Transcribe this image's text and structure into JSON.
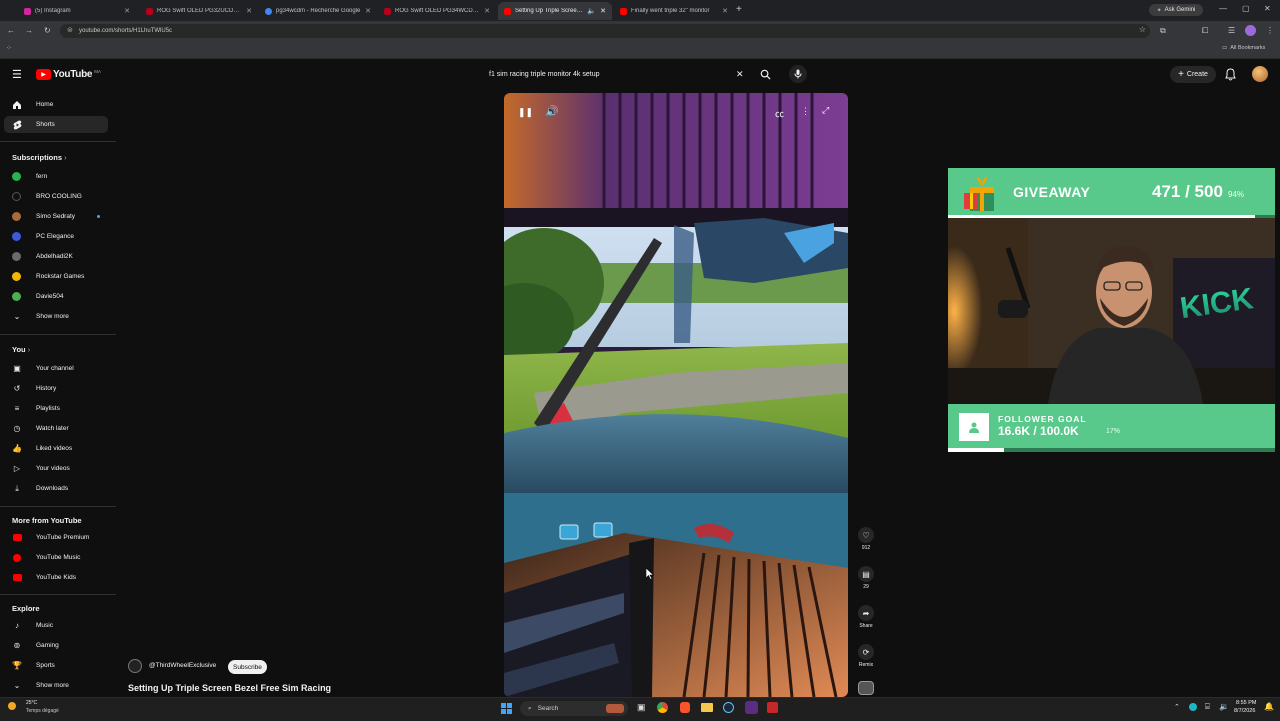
{
  "browser": {
    "tabs": [
      {
        "label": "(5) Instagram",
        "color": "#d6249f"
      },
      {
        "label": "ROG Swift OLED PG32UCDM3 |",
        "color": "#b3001b"
      },
      {
        "label": "pg34wcdm - Recherche Google",
        "color": "#4285f4"
      },
      {
        "label": "ROG Swift OLED PG34WCDM |",
        "color": "#b3001b"
      },
      {
        "label": "Setting Up Triple Screen Be",
        "color": "#ff0000"
      },
      {
        "label": "Finally went triple 32\" monitor",
        "color": "#ff0000"
      }
    ],
    "gemini": "Ask Gemini",
    "url": "youtube.com/shorts/H1LhuTWlU5c",
    "all_bookmarks": "All Bookmarks"
  },
  "youtube": {
    "logo": "YouTube",
    "region": "MA",
    "search_query": "f1 sim racing triple monitor 4k setup",
    "create": "Create"
  },
  "sidebar": {
    "main": [
      {
        "label": "Home",
        "icon": "home-icon"
      },
      {
        "label": "Shorts",
        "icon": "shorts-icon"
      }
    ],
    "subscriptions_title": "Subscriptions",
    "subscriptions": [
      {
        "label": "fern",
        "color": "#2bb24c"
      },
      {
        "label": "BRO COOLING",
        "color": "#111111"
      },
      {
        "label": "Simo Sedraty",
        "color": "#a86b3c"
      },
      {
        "label": "PC Elegance",
        "color": "#3b5bdb"
      },
      {
        "label": "Abdelhadi2K",
        "color": "#6b6b6b"
      },
      {
        "label": "Rockstar Games",
        "color": "#f2b705"
      },
      {
        "label": "Davie504",
        "color": "#4caf50"
      }
    ],
    "show_more": "Show more",
    "you_title": "You",
    "you": [
      {
        "label": "Your channel",
        "icon": "channel-icon"
      },
      {
        "label": "History",
        "icon": "history-icon"
      },
      {
        "label": "Playlists",
        "icon": "playlist-icon"
      },
      {
        "label": "Watch later",
        "icon": "clock-icon"
      },
      {
        "label": "Liked videos",
        "icon": "like-icon"
      },
      {
        "label": "Your videos",
        "icon": "video-icon"
      },
      {
        "label": "Downloads",
        "icon": "download-icon"
      }
    ],
    "more_title": "More from YouTube",
    "more": [
      {
        "label": "YouTube Premium"
      },
      {
        "label": "YouTube Music"
      },
      {
        "label": "YouTube Kids"
      }
    ],
    "explore_title": "Explore",
    "explore": [
      {
        "label": "Music",
        "icon": "music-icon"
      },
      {
        "label": "Gaming",
        "icon": "gaming-icon"
      },
      {
        "label": "Sports",
        "icon": "trophy-icon"
      }
    ],
    "explore_more": "Show more"
  },
  "short": {
    "channel": "@ThirdWheelExclusive",
    "subscribe": "Subscribe",
    "title": "Setting Up Triple Screen Bezel Free Sim Racing",
    "likes": "912",
    "comments": "29",
    "share": "Share",
    "remix": "Remix"
  },
  "overlay": {
    "giveaway": "GIVEAWAY",
    "giveaway_count": "471 / 500",
    "giveaway_pct": "94%",
    "giveaway_progress": 0.94,
    "follower_label": "FOLLOWER GOAL",
    "follower_count": "16.6K / 100.0K",
    "follower_pct": "17%",
    "follower_progress": 0.17,
    "logo_text": "KICK",
    "accent": "#5ee08c"
  },
  "taskbar": {
    "weather_temp": "25°C",
    "weather_desc": "Temps dégagé",
    "search": "Search",
    "time": "8:55 PM",
    "date": "8/7/2026"
  }
}
